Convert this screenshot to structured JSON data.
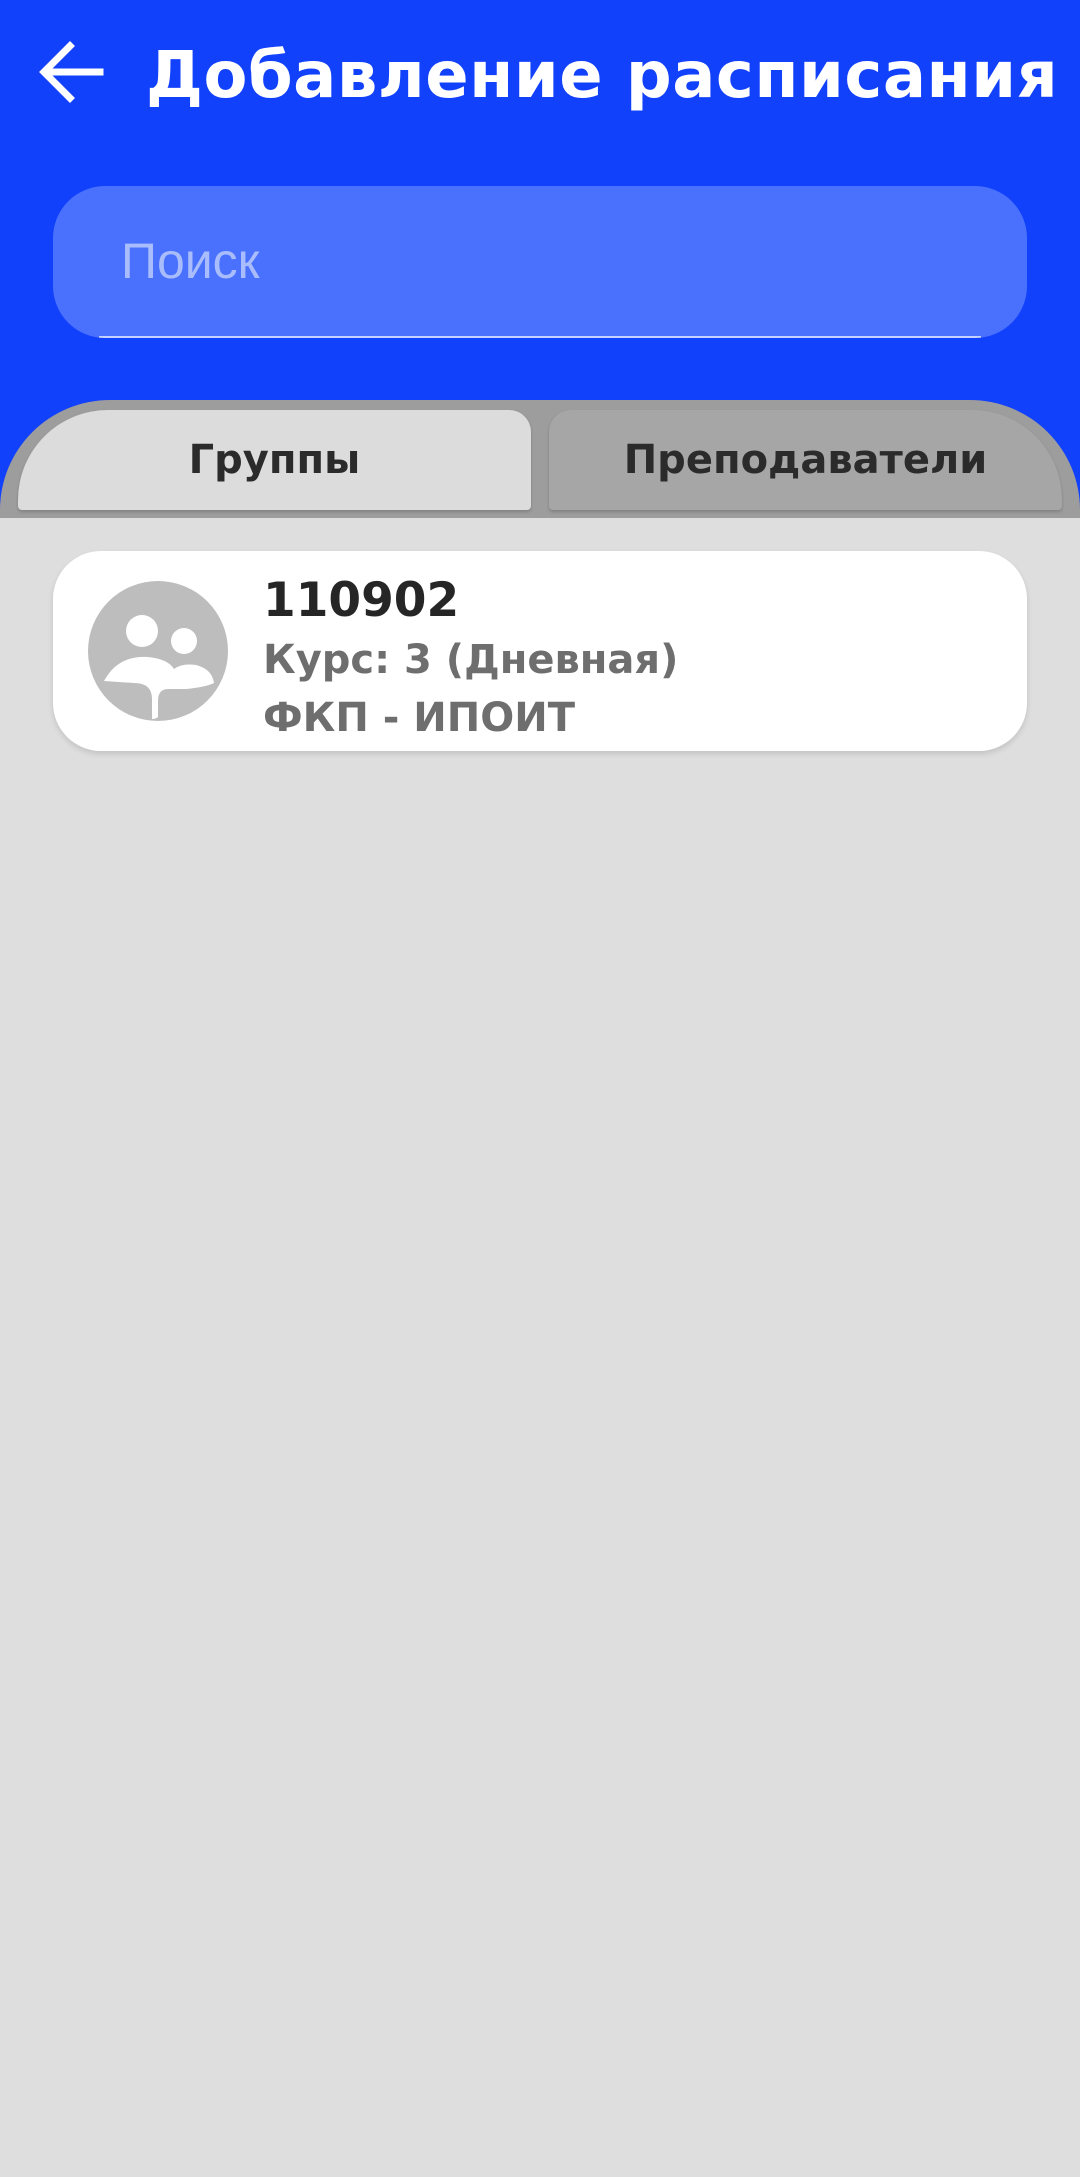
{
  "header": {
    "title": "Добавление расписания",
    "back_icon": "arrow-left-icon",
    "background_color": "#1241fb"
  },
  "search": {
    "placeholder": "Поиск",
    "value": "",
    "background_color": "#4a71fe"
  },
  "tabs": [
    {
      "label": "Группы",
      "selected": true
    },
    {
      "label": "Преподаватели",
      "selected": false
    }
  ],
  "groups": [
    {
      "id": "110902",
      "course": "Курс: 3 (Дневная)",
      "faculty": "ФКП - ИПОИТ",
      "icon": "group-avatar-icon"
    }
  ]
}
